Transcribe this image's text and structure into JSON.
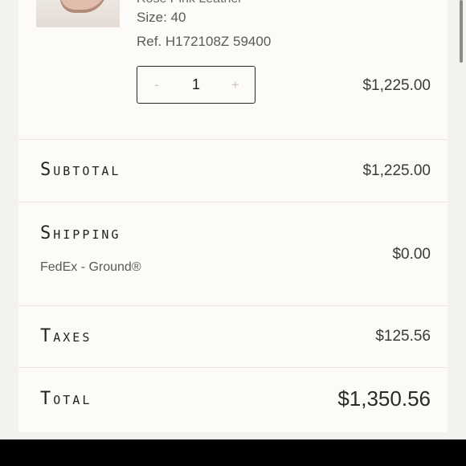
{
  "item": {
    "partial_text": "Rose Pink Leather",
    "size": "Size: 40",
    "ref": "Ref. H172108Z 59400",
    "quantity": "1",
    "decrement_label": "-",
    "increment_label": "+",
    "line_price": "$1,225.00"
  },
  "summary": {
    "subtotal_label": "Subtotal",
    "subtotal_value": "$1,225.00",
    "shipping_label": "Shipping",
    "shipping_method": "FedEx - Ground®",
    "shipping_value": "$0.00",
    "taxes_label": "Taxes",
    "taxes_value": "$125.56",
    "total_label": "Total",
    "total_value": "$1,350.56"
  }
}
